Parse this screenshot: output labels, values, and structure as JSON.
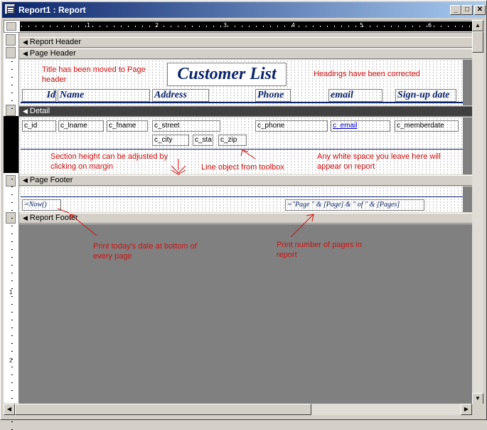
{
  "window": {
    "title": "Report1 : Report",
    "minimize": "_",
    "maximize": "□",
    "close": "✕"
  },
  "ruler": {
    "marks": [
      "1",
      "2",
      "3",
      "4",
      "5",
      "6"
    ]
  },
  "vruler": {
    "marks": [
      "1",
      "2"
    ]
  },
  "sections": {
    "report_header": "Report Header",
    "page_header": "Page Header",
    "detail": "Detail",
    "page_footer": "Page Footer",
    "report_footer": "Report Footer"
  },
  "page_header": {
    "title": "Customer List",
    "headings": [
      "Id",
      "Name",
      "Address",
      "Phone",
      "email",
      "Sign-up date"
    ]
  },
  "detail": {
    "fields": {
      "id": "c_id",
      "lname": "c_lname",
      "fname": "c_fname",
      "street": "c_street",
      "phone": "c_phone",
      "email": "c_email",
      "memberdate": "c_memberdate",
      "city": "c_city",
      "state": "c_sta",
      "zip": "c_zip"
    }
  },
  "page_footer": {
    "date_expr": "=Now()",
    "page_expr": "=\"Page \" & [Page] & \" of \" & [Pages]"
  },
  "notes": {
    "title_moved": "Title has been moved to Page header",
    "headings_corrected": "Headings have been corrected",
    "section_height": "Section height can be adjusted by clicking on margin",
    "line_object": "Line object from toolbox",
    "white_space": "Any white space you leave here will appear on report",
    "print_date": "Print today's date at bottom of every page",
    "print_pages": "Print number of pages in report"
  },
  "colors": {
    "annotation": "#d01010",
    "heading": "#0a246a",
    "titlebar": "#0a246a"
  }
}
